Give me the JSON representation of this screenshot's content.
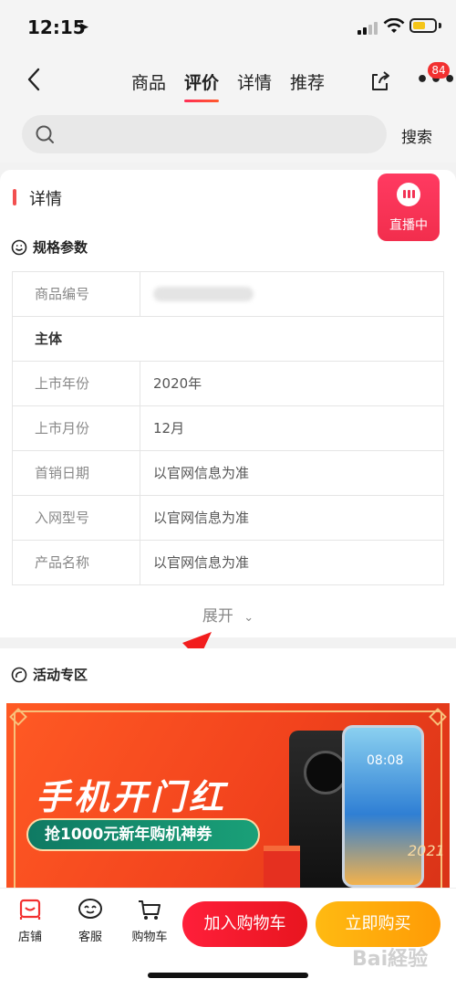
{
  "status_bar": {
    "time": "12:15",
    "battery_level": 0.6,
    "battery_color": "#f5c518"
  },
  "nav": {
    "tabs": [
      {
        "label": "商品",
        "active": false
      },
      {
        "label": "评价",
        "active": true
      },
      {
        "label": "详情",
        "active": false
      },
      {
        "label": "推荐",
        "active": false
      }
    ],
    "badge_count": "84"
  },
  "search": {
    "placeholder": "",
    "button_label": "搜索"
  },
  "detail": {
    "title": "详情",
    "live_label": "直播中",
    "spec_heading": "规格参数",
    "rows": [
      {
        "key": "商品编号",
        "value": ""
      },
      {
        "key": "主体",
        "value": ""
      },
      {
        "key": "上市年份",
        "value": "2020年"
      },
      {
        "key": "上市月份",
        "value": "12月"
      },
      {
        "key": "首销日期",
        "value": "以官网信息为准"
      },
      {
        "key": "入网型号",
        "value": "以官网信息为准"
      },
      {
        "key": "产品名称",
        "value": "以官网信息为准"
      }
    ],
    "expand_label": "展开"
  },
  "activity": {
    "heading": "活动专区",
    "banner_title": "手机开门红",
    "coupon_text": "抢1000元新年购机神券",
    "phone_time": "08:08",
    "year_mark": "2021"
  },
  "bottom": {
    "shop_label": "店铺",
    "service_label": "客服",
    "cart_label": "购物车",
    "add_cart_label": "加入购物车",
    "buy_label": "立即购买"
  },
  "colors": {
    "accent_red": "#f23030",
    "buy_orange": "#ffa30a",
    "live_pink": "#ff3a61"
  },
  "watermark": "Bai経验"
}
